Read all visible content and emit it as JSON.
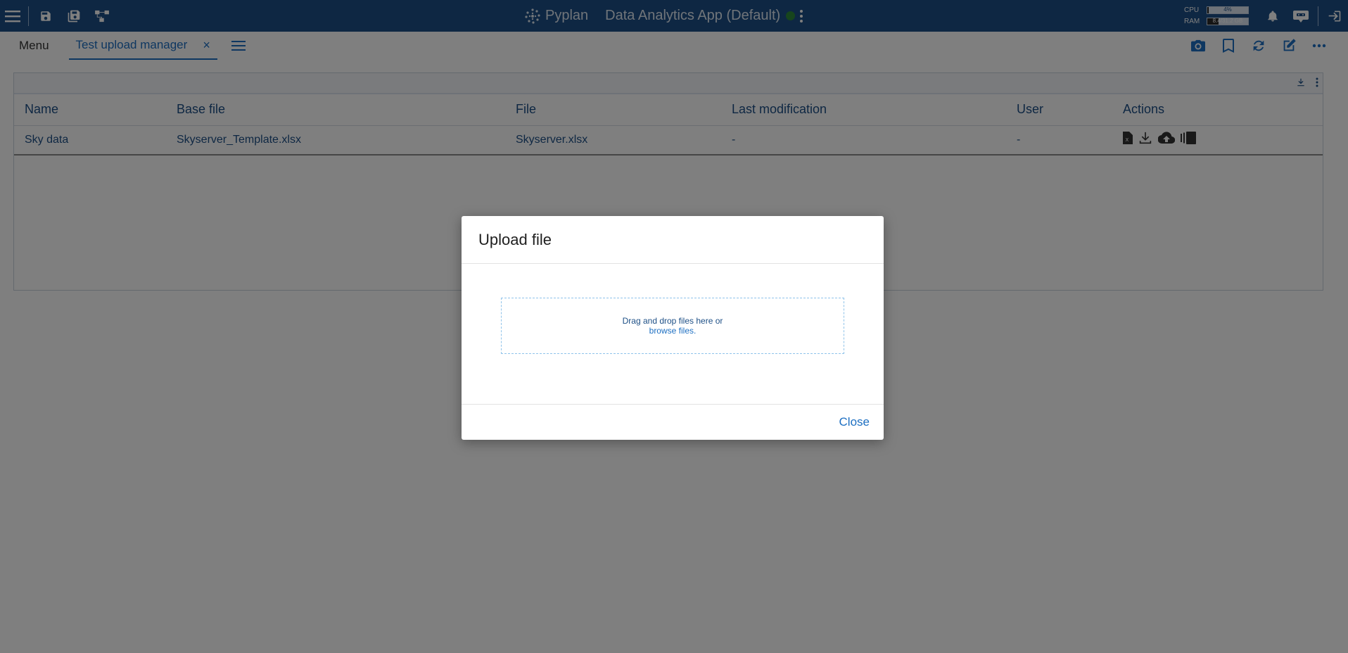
{
  "topbar": {
    "brand": "Pyplan",
    "app_title": "Data Analytics App (Default)",
    "cpu_label": "CPU",
    "cpu_value": "4%",
    "cpu_fraction": 0.04,
    "ram_label": "RAM",
    "ram_value": "8.4/31.2 GB",
    "ram_fraction": 0.27,
    "status_color": "#2e8b3a"
  },
  "subbar": {
    "menu_label": "Menu",
    "tab_label": "Test upload manager",
    "tab_close": "×"
  },
  "table": {
    "columns": [
      "Name",
      "Base file",
      "File",
      "Last modification",
      "User",
      "Actions"
    ],
    "rows": [
      {
        "name": "Sky data",
        "base_file": "Skyserver_Template.xlsx",
        "file": "Skyserver.xlsx",
        "last_modification": "-",
        "user": "-"
      }
    ]
  },
  "modal": {
    "title": "Upload file",
    "drop_text": "Drag and drop files here or",
    "browse_text": "browse files.",
    "close_label": "Close"
  },
  "colors": {
    "topbar_bg": "#1d4f86",
    "accent": "#1d6fc2"
  }
}
